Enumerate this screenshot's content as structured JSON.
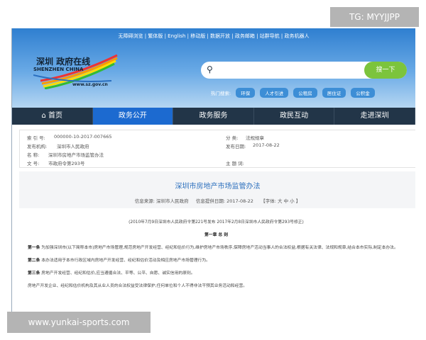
{
  "watermarks": {
    "top": "TG: MYYJJPP",
    "bottom": "www.yunkai-sports.com"
  },
  "header": {
    "top_links": "无障碍浏览 | 繁体版 | English | 移动版 | 数据开放 | 政务邮箱 | 站群导航 | 政务机器人",
    "logo": {
      "cn": "深圳 政府在线",
      "en": "SHENZHEN CHINA",
      "url": "www.sz.gov.cn"
    },
    "search": {
      "placeholder": "",
      "button": "搜一下"
    },
    "hot_label": "热门搜索:",
    "hot_tags": [
      "环保",
      "人才引进",
      "公租房",
      "居住证",
      "公积金"
    ]
  },
  "nav": [
    {
      "label": "⌂ 首页"
    },
    {
      "label": "政务公开",
      "active": true
    },
    {
      "label": "政务服务"
    },
    {
      "label": "政民互动"
    },
    {
      "label": "走进深圳"
    }
  ],
  "meta": {
    "index_label": "索 引 号:",
    "index": "000000-10-2017-007665",
    "category_label": "分 类:",
    "category": "法规规章",
    "org_label": "发布机构:",
    "org": "深圳市人民政府",
    "date_label": "发布日期:",
    "date": "2017-08-22",
    "name_label": "名 称:",
    "name": "深圳市房地产市场监管办法",
    "doc_label": "文 号:",
    "doc": "市政府令第293号",
    "subject_label": "主 题 词:"
  },
  "article": {
    "title": "深圳市房地产市场监管办法",
    "source": "信息来源: 深圳市人民政府",
    "provided": "信息提供日期: 2017-08-22",
    "font": "【字体: 大 中 小 】",
    "note": "(2010年7月9日深圳市人民政府令第221号发布 2017年2月8日深圳市人民政府令第293号修正)",
    "chapter": "第一章 总 则",
    "a1_label": "第一条",
    "a1": "为加强深圳市(以下简称本市)房地产市场管理,规范房地产开发经营、经纪和估价行为,维护房地产市场秩序,保障房地产活动当事人的合法权益,根据有关法律、法规和规章,结合本市实际,制定本办法。",
    "a2_label": "第二条",
    "a2": "本办法适用于本市行政区域内房地产开发经营、经纪和估价活动及相应房地产市场管理行为。",
    "a3_label": "第三条",
    "a3": "房地产开发经营、经纪和估价,应当遵循合法、平等、公平、自愿、诚实信用的原则。",
    "p4": "房地产开发企业、经纪和估价机构及其从业人员的合法权益受法律保护,任何单位和个人不得非法干预其业务活动和经营。"
  }
}
